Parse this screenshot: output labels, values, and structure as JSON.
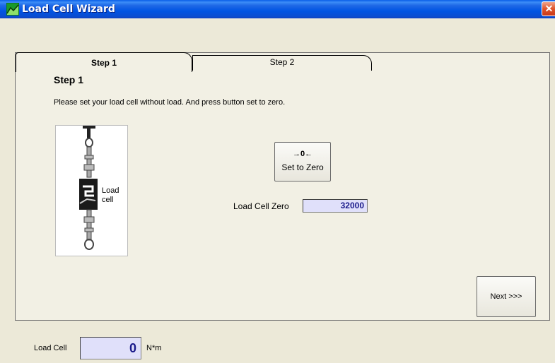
{
  "window": {
    "title": "Load Cell Wizard",
    "close_glyph": "✕",
    "title_bar_color": "#0054e3"
  },
  "tabs": [
    {
      "label": "Step 1",
      "active": true
    },
    {
      "label": "Step 2",
      "active": false
    }
  ],
  "step": {
    "heading": "Step 1",
    "instructions": "Please set your load cell without load. And press button set to zero.",
    "illustration": {
      "icon": "load-cell-diagram-icon",
      "label_line1": "Load",
      "label_line2": "cell"
    }
  },
  "zero_button": {
    "icon_text": "→0←",
    "label": "Set to Zero"
  },
  "zero_field": {
    "label": "Load Cell Zero",
    "value": "32000"
  },
  "next_button": {
    "label": "Next >>>"
  },
  "status": {
    "label": "Load Cell",
    "value": "0",
    "unit": "N*m",
    "field_color": "#e0e0fa"
  }
}
